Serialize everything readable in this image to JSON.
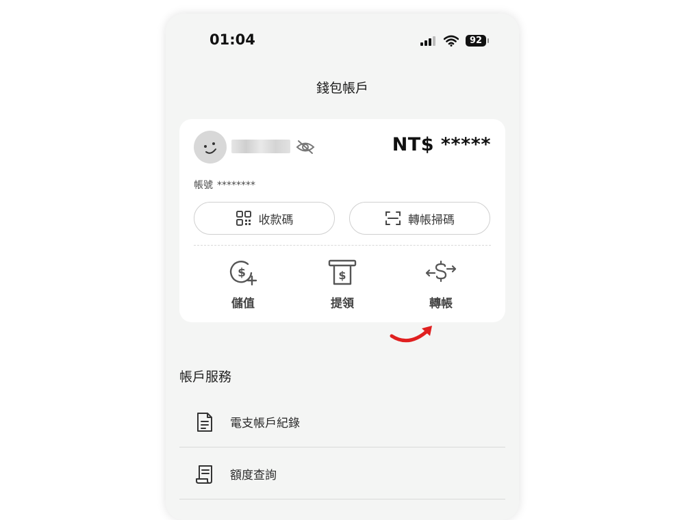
{
  "status_bar": {
    "time": "01:04",
    "battery": "92"
  },
  "header": {
    "title": "錢包帳戶"
  },
  "wallet_card": {
    "balance": "NT$ *****",
    "account_label": "帳號",
    "account_number": "********",
    "receive_code_label": "收款碼",
    "transfer_scan_label": "轉帳掃碼",
    "actions": [
      {
        "label": "儲值",
        "icon": "dollar-plus-icon"
      },
      {
        "label": "提領",
        "icon": "atm-withdraw-icon"
      },
      {
        "label": "轉帳",
        "icon": "transfer-arrows-icon"
      }
    ]
  },
  "account_services": {
    "title": "帳戶服務",
    "items": [
      {
        "label": "電支帳戶紀錄",
        "icon": "document-icon"
      },
      {
        "label": "額度查詢",
        "icon": "receipt-icon"
      }
    ]
  },
  "colors": {
    "background": "#f4f5f4",
    "card": "#ffffff",
    "annotation_arrow": "#e02020"
  }
}
